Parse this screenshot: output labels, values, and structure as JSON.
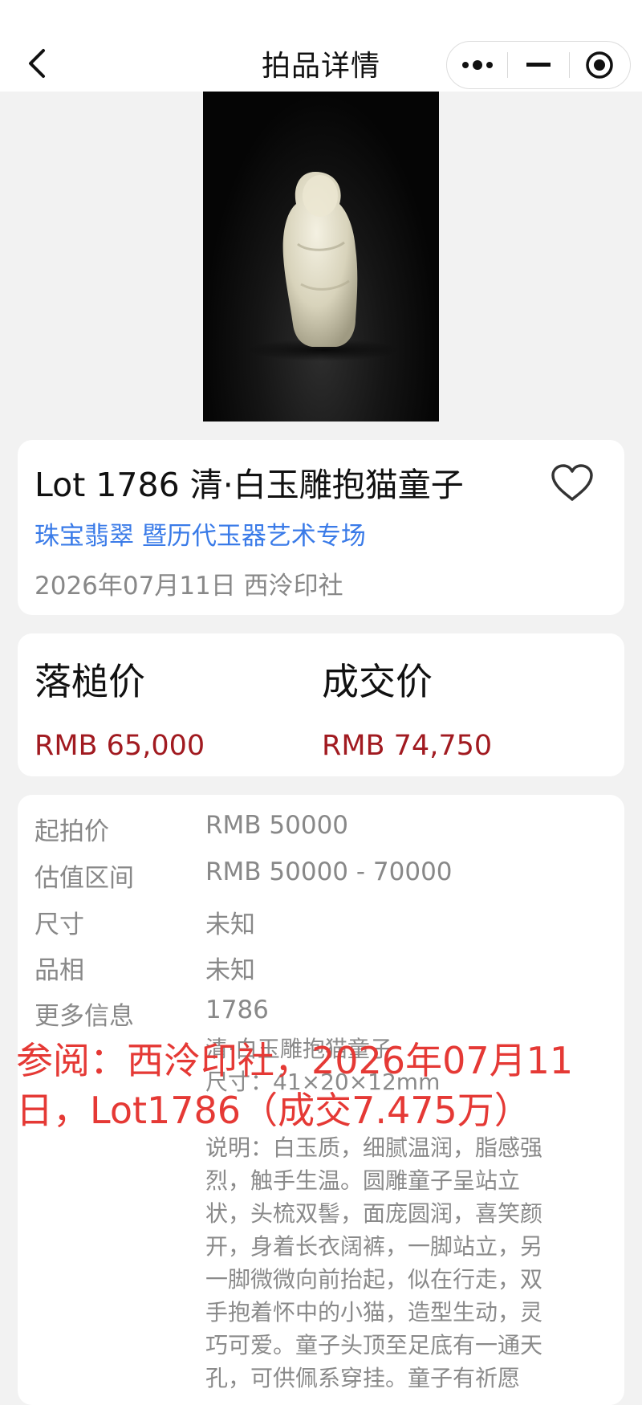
{
  "navbar": {
    "title": "拍品详情",
    "back_icon": "chevron-left-icon",
    "capsule": {
      "more_icon": "more-dots-icon",
      "minimize_icon": "minimize-icon",
      "close_icon": "target-close-icon"
    }
  },
  "hero_image": {
    "description_icon": "jade-figure-image"
  },
  "lot": {
    "title": "Lot 1786 清·白玉雕抱猫童子",
    "session": "珠宝翡翠 暨历代玉器艺术专场",
    "sale_meta": "2026年07月11日 西泠印社",
    "favorite_icon": "heart-outline-icon"
  },
  "prices": {
    "hammer_label": "落槌价",
    "hammer_value": "RMB 65,000",
    "deal_label": "成交价",
    "deal_value": "RMB 74,750"
  },
  "details": {
    "rows": [
      {
        "label": "起拍价",
        "value": "RMB 50000"
      },
      {
        "label": "估值区间",
        "value": "RMB 50000 - 70000"
      },
      {
        "label": "尺寸",
        "value": "未知"
      },
      {
        "label": "品相",
        "value": "未知"
      },
      {
        "label": "更多信息",
        "value": "1786"
      }
    ],
    "more_lines": [
      "清·白玉雕抱猫童子",
      "尺寸：41×20×12mm",
      "",
      "说明：白玉质，细腻温润，脂感强",
      "烈，触手生温。圆雕童子呈站立",
      "状，头梳双髻，面庞圆润，喜笑颜",
      "开，身着长衣阔裤，一脚站立，另",
      "一脚微微向前抬起，似在行走，双",
      "手抱着怀中的小猫，造型生动，灵",
      "巧可爱。童子头顶至足底有一通天",
      "孔，可供佩系穿挂。童子有祈愿"
    ]
  },
  "overlay": {
    "line1": "参阅：西泠印社，2026年07月11",
    "line2": "日，Lot1786（成交7.475万）"
  },
  "colors": {
    "link": "#3a7be8",
    "price": "#a11a20",
    "overlay": "#e53935"
  }
}
